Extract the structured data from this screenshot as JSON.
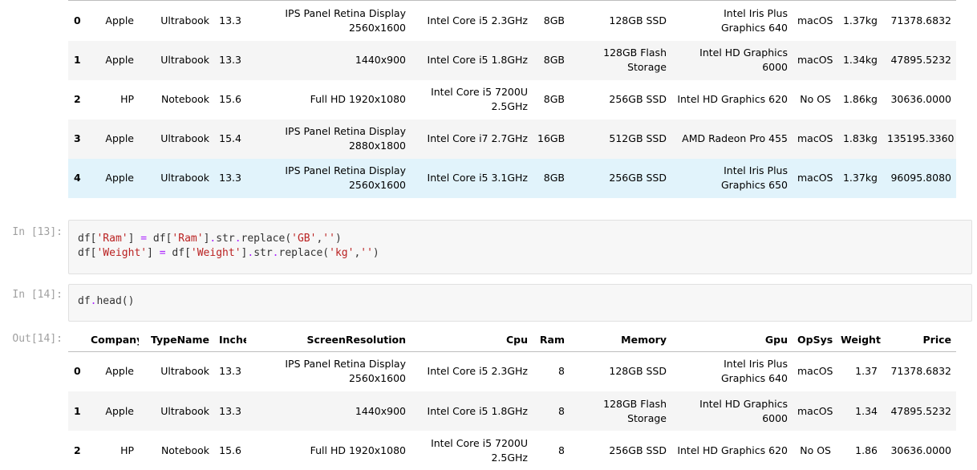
{
  "top_table": {
    "rows": [
      {
        "idx": "0",
        "Company": "Apple",
        "TypeName": "Ultrabook",
        "Inches": "13.3",
        "ScreenResolution": "IPS Panel Retina Display 2560x1600",
        "Cpu": "Intel Core i5 2.3GHz",
        "Ram": "8GB",
        "Memory": "128GB SSD",
        "Gpu": "Intel Iris Plus Graphics 640",
        "OpSys": "macOS",
        "Weight": "1.37kg",
        "Price": "71378.6832"
      },
      {
        "idx": "1",
        "Company": "Apple",
        "TypeName": "Ultrabook",
        "Inches": "13.3",
        "ScreenResolution": "1440x900",
        "Cpu": "Intel Core i5 1.8GHz",
        "Ram": "8GB",
        "Memory": "128GB Flash Storage",
        "Gpu": "Intel HD Graphics 6000",
        "OpSys": "macOS",
        "Weight": "1.34kg",
        "Price": "47895.5232"
      },
      {
        "idx": "2",
        "Company": "HP",
        "TypeName": "Notebook",
        "Inches": "15.6",
        "ScreenResolution": "Full HD 1920x1080",
        "Cpu": "Intel Core i5 7200U 2.5GHz",
        "Ram": "8GB",
        "Memory": "256GB SSD",
        "Gpu": "Intel HD Graphics 620",
        "OpSys": "No OS",
        "Weight": "1.86kg",
        "Price": "30636.0000"
      },
      {
        "idx": "3",
        "Company": "Apple",
        "TypeName": "Ultrabook",
        "Inches": "15.4",
        "ScreenResolution": "IPS Panel Retina Display 2880x1800",
        "Cpu": "Intel Core i7 2.7GHz",
        "Ram": "16GB",
        "Memory": "512GB SSD",
        "Gpu": "AMD Radeon Pro 455",
        "OpSys": "macOS",
        "Weight": "1.83kg",
        "Price": "135195.3360"
      },
      {
        "idx": "4",
        "Company": "Apple",
        "TypeName": "Ultrabook",
        "Inches": "13.3",
        "ScreenResolution": "IPS Panel Retina Display 2560x1600",
        "Cpu": "Intel Core i5 3.1GHz",
        "Ram": "8GB",
        "Memory": "256GB SSD",
        "Gpu": "Intel Iris Plus Graphics 650",
        "OpSys": "macOS",
        "Weight": "1.37kg",
        "Price": "96095.8080"
      }
    ]
  },
  "cell13": {
    "prompt": "In [13]:",
    "line1": {
      "a": "df[",
      "b": "'Ram'",
      "c": "] ",
      "d": "=",
      "e": " df[",
      "f": "'Ram'",
      "g": "]",
      "h": ".",
      "i": "str",
      "j": ".",
      "k": "replace(",
      "l": "'GB'",
      "m": ",",
      "n": "''",
      "o": ")"
    },
    "line2": {
      "a": "df[",
      "b": "'Weight'",
      "c": "] ",
      "d": "=",
      "e": " df[",
      "f": "'Weight'",
      "g": "]",
      "h": ".",
      "i": "str",
      "j": ".",
      "k": "replace(",
      "l": "'kg'",
      "m": ",",
      "n": "''",
      "o": ")"
    }
  },
  "cell14": {
    "prompt": "In [14]:",
    "code": {
      "a": "df",
      "b": ".",
      "c": "head()"
    }
  },
  "out14": {
    "prompt": "Out[14]:",
    "columns": [
      "Company",
      "TypeName",
      "Inches",
      "ScreenResolution",
      "Cpu",
      "Ram",
      "Memory",
      "Gpu",
      "OpSys",
      "Weight",
      "Price"
    ],
    "rows": [
      {
        "idx": "0",
        "Company": "Apple",
        "TypeName": "Ultrabook",
        "Inches": "13.3",
        "ScreenResolution": "IPS Panel Retina Display 2560x1600",
        "Cpu": "Intel Core i5 2.3GHz",
        "Ram": "8",
        "Memory": "128GB SSD",
        "Gpu": "Intel Iris Plus Graphics 640",
        "OpSys": "macOS",
        "Weight": "1.37",
        "Price": "71378.6832"
      },
      {
        "idx": "1",
        "Company": "Apple",
        "TypeName": "Ultrabook",
        "Inches": "13.3",
        "ScreenResolution": "1440x900",
        "Cpu": "Intel Core i5 1.8GHz",
        "Ram": "8",
        "Memory": "128GB Flash Storage",
        "Gpu": "Intel HD Graphics 6000",
        "OpSys": "macOS",
        "Weight": "1.34",
        "Price": "47895.5232"
      },
      {
        "idx": "2",
        "Company": "HP",
        "TypeName": "Notebook",
        "Inches": "15.6",
        "ScreenResolution": "Full HD 1920x1080",
        "Cpu": "Intel Core i5 7200U 2.5GHz",
        "Ram": "8",
        "Memory": "256GB SSD",
        "Gpu": "Intel HD Graphics 620",
        "OpSys": "No OS",
        "Weight": "1.86",
        "Price": "30636.0000"
      }
    ]
  }
}
